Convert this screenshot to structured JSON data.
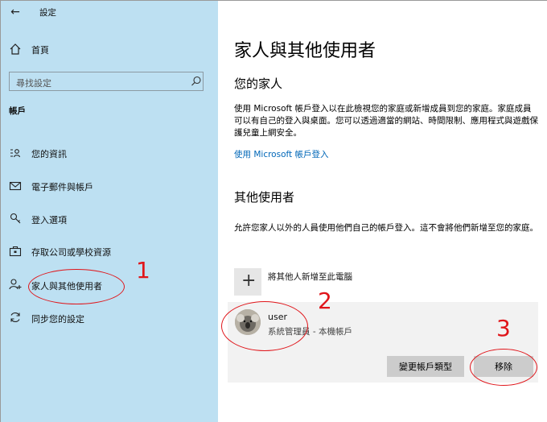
{
  "window": {
    "back_glyph": "←",
    "title": "設定"
  },
  "sidebar": {
    "home_label": "首頁",
    "search_placeholder": "尋找設定",
    "section_title": "帳戶",
    "items": [
      {
        "label": "您的資訊",
        "icon": "person-card-icon"
      },
      {
        "label": "電子郵件與帳戶",
        "icon": "mail-icon"
      },
      {
        "label": "登入選項",
        "icon": "key-icon"
      },
      {
        "label": "存取公司或學校資源",
        "icon": "briefcase-icon"
      },
      {
        "label": "家人與其他使用者",
        "icon": "person-add-icon"
      },
      {
        "label": "同步您的設定",
        "icon": "sync-icon"
      }
    ]
  },
  "main": {
    "title": "家人與其他使用者",
    "family": {
      "heading": "您的家人",
      "description": "使用 Microsoft 帳戶登入以在此檢視您的家庭或新增成員到您的家庭。家庭成員可以有自己的登入與桌面。您可以透過適當的網站、時間限制、應用程式與遊戲保護兒童上網安全。",
      "link": "使用 Microsoft 帳戶登入"
    },
    "others": {
      "heading": "其他使用者",
      "description": "允許您家人以外的人員使用他們自己的帳戶登入。這不會將他們新增至您的家庭。",
      "add_label": "將其他人新增至此電腦",
      "add_glyph": "+",
      "user": {
        "name": "user",
        "subtitle": "系統管理員 - 本機帳戶"
      },
      "change_type_button": "變更帳戶類型",
      "remove_button": "移除"
    }
  },
  "annotations": {
    "n1": "1",
    "n2": "2",
    "n3": "3",
    "color": "#e0151a"
  },
  "colors": {
    "sidebar_bg": "#bde0f2",
    "link": "#0067b8",
    "button_bg": "#cccccc",
    "panel_bg": "#f2f2f2"
  }
}
